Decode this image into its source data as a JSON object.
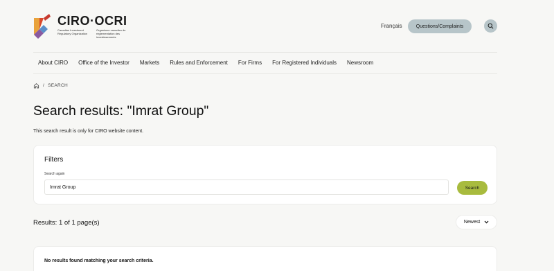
{
  "header": {
    "logo": {
      "name": "CIRO·OCRI",
      "sub_en": "Canadian Investment Regulatory Organization",
      "sub_fr": "Organisme canadien de réglementation des investissements"
    },
    "language_link": "Français",
    "questions_button": "Questions/Complaints"
  },
  "nav": {
    "items": [
      "About CIRO",
      "Office of the Investor",
      "Markets",
      "Rules and Enforcement",
      "For Firms",
      "For Registered Individuals",
      "Newsroom"
    ]
  },
  "breadcrumb": {
    "separator": "/",
    "current": "SEARCH"
  },
  "main": {
    "title": "Search results: \"Imrat Group\"",
    "subtitle": "This search result is only for CIRO website content."
  },
  "filters": {
    "title": "Filters",
    "search_label": "Search again",
    "search_value": "Imrat Group",
    "search_button": "Search"
  },
  "results": {
    "count_text": "Results: 1 of 1 page(s)",
    "sort_value": "Newest",
    "empty_message": "No results found matching your search criteria."
  },
  "colors": {
    "accent_green": "#a8bb3e",
    "button_grey_blue": "#b7c5c9",
    "background": "#f7f7f5"
  }
}
